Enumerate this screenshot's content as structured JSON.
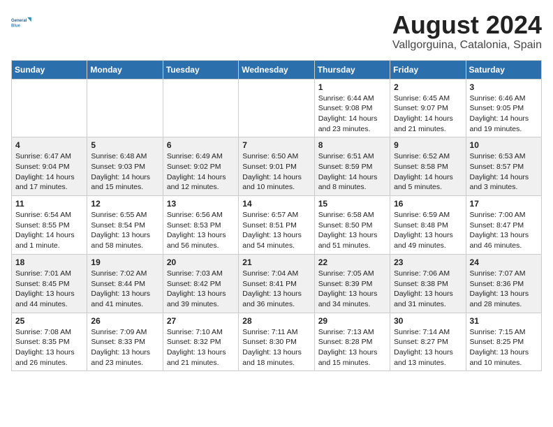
{
  "header": {
    "logo_line1": "General",
    "logo_line2": "Blue",
    "month_year": "August 2024",
    "location": "Vallgorguina, Catalonia, Spain"
  },
  "weekdays": [
    "Sunday",
    "Monday",
    "Tuesday",
    "Wednesday",
    "Thursday",
    "Friday",
    "Saturday"
  ],
  "weeks": [
    [
      {
        "day": "",
        "info": ""
      },
      {
        "day": "",
        "info": ""
      },
      {
        "day": "",
        "info": ""
      },
      {
        "day": "",
        "info": ""
      },
      {
        "day": "1",
        "info": "Sunrise: 6:44 AM\nSunset: 9:08 PM\nDaylight: 14 hours\nand 23 minutes."
      },
      {
        "day": "2",
        "info": "Sunrise: 6:45 AM\nSunset: 9:07 PM\nDaylight: 14 hours\nand 21 minutes."
      },
      {
        "day": "3",
        "info": "Sunrise: 6:46 AM\nSunset: 9:05 PM\nDaylight: 14 hours\nand 19 minutes."
      }
    ],
    [
      {
        "day": "4",
        "info": "Sunrise: 6:47 AM\nSunset: 9:04 PM\nDaylight: 14 hours\nand 17 minutes."
      },
      {
        "day": "5",
        "info": "Sunrise: 6:48 AM\nSunset: 9:03 PM\nDaylight: 14 hours\nand 15 minutes."
      },
      {
        "day": "6",
        "info": "Sunrise: 6:49 AM\nSunset: 9:02 PM\nDaylight: 14 hours\nand 12 minutes."
      },
      {
        "day": "7",
        "info": "Sunrise: 6:50 AM\nSunset: 9:01 PM\nDaylight: 14 hours\nand 10 minutes."
      },
      {
        "day": "8",
        "info": "Sunrise: 6:51 AM\nSunset: 8:59 PM\nDaylight: 14 hours\nand 8 minutes."
      },
      {
        "day": "9",
        "info": "Sunrise: 6:52 AM\nSunset: 8:58 PM\nDaylight: 14 hours\nand 5 minutes."
      },
      {
        "day": "10",
        "info": "Sunrise: 6:53 AM\nSunset: 8:57 PM\nDaylight: 14 hours\nand 3 minutes."
      }
    ],
    [
      {
        "day": "11",
        "info": "Sunrise: 6:54 AM\nSunset: 8:55 PM\nDaylight: 14 hours\nand 1 minute."
      },
      {
        "day": "12",
        "info": "Sunrise: 6:55 AM\nSunset: 8:54 PM\nDaylight: 13 hours\nand 58 minutes."
      },
      {
        "day": "13",
        "info": "Sunrise: 6:56 AM\nSunset: 8:53 PM\nDaylight: 13 hours\nand 56 minutes."
      },
      {
        "day": "14",
        "info": "Sunrise: 6:57 AM\nSunset: 8:51 PM\nDaylight: 13 hours\nand 54 minutes."
      },
      {
        "day": "15",
        "info": "Sunrise: 6:58 AM\nSunset: 8:50 PM\nDaylight: 13 hours\nand 51 minutes."
      },
      {
        "day": "16",
        "info": "Sunrise: 6:59 AM\nSunset: 8:48 PM\nDaylight: 13 hours\nand 49 minutes."
      },
      {
        "day": "17",
        "info": "Sunrise: 7:00 AM\nSunset: 8:47 PM\nDaylight: 13 hours\nand 46 minutes."
      }
    ],
    [
      {
        "day": "18",
        "info": "Sunrise: 7:01 AM\nSunset: 8:45 PM\nDaylight: 13 hours\nand 44 minutes."
      },
      {
        "day": "19",
        "info": "Sunrise: 7:02 AM\nSunset: 8:44 PM\nDaylight: 13 hours\nand 41 minutes."
      },
      {
        "day": "20",
        "info": "Sunrise: 7:03 AM\nSunset: 8:42 PM\nDaylight: 13 hours\nand 39 minutes."
      },
      {
        "day": "21",
        "info": "Sunrise: 7:04 AM\nSunset: 8:41 PM\nDaylight: 13 hours\nand 36 minutes."
      },
      {
        "day": "22",
        "info": "Sunrise: 7:05 AM\nSunset: 8:39 PM\nDaylight: 13 hours\nand 34 minutes."
      },
      {
        "day": "23",
        "info": "Sunrise: 7:06 AM\nSunset: 8:38 PM\nDaylight: 13 hours\nand 31 minutes."
      },
      {
        "day": "24",
        "info": "Sunrise: 7:07 AM\nSunset: 8:36 PM\nDaylight: 13 hours\nand 28 minutes."
      }
    ],
    [
      {
        "day": "25",
        "info": "Sunrise: 7:08 AM\nSunset: 8:35 PM\nDaylight: 13 hours\nand 26 minutes."
      },
      {
        "day": "26",
        "info": "Sunrise: 7:09 AM\nSunset: 8:33 PM\nDaylight: 13 hours\nand 23 minutes."
      },
      {
        "day": "27",
        "info": "Sunrise: 7:10 AM\nSunset: 8:32 PM\nDaylight: 13 hours\nand 21 minutes."
      },
      {
        "day": "28",
        "info": "Sunrise: 7:11 AM\nSunset: 8:30 PM\nDaylight: 13 hours\nand 18 minutes."
      },
      {
        "day": "29",
        "info": "Sunrise: 7:13 AM\nSunset: 8:28 PM\nDaylight: 13 hours\nand 15 minutes."
      },
      {
        "day": "30",
        "info": "Sunrise: 7:14 AM\nSunset: 8:27 PM\nDaylight: 13 hours\nand 13 minutes."
      },
      {
        "day": "31",
        "info": "Sunrise: 7:15 AM\nSunset: 8:25 PM\nDaylight: 13 hours\nand 10 minutes."
      }
    ]
  ]
}
